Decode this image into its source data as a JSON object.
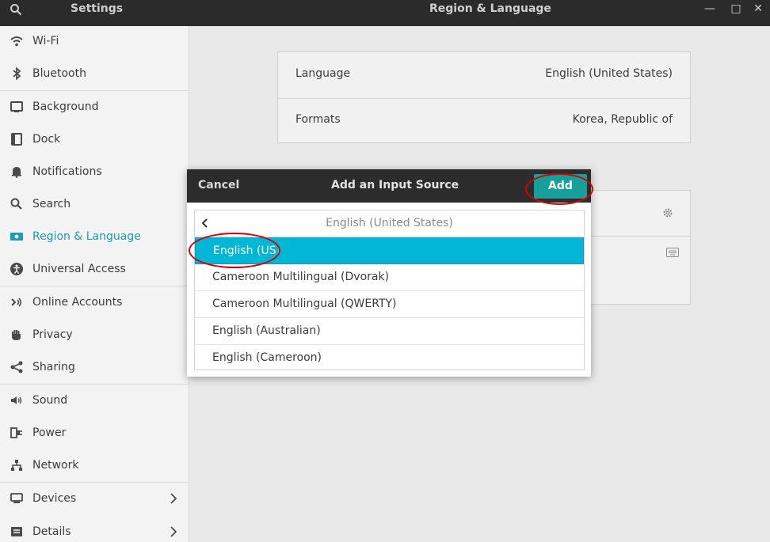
{
  "header": {
    "app_title": "Settings",
    "page_title": "Region & Language",
    "search_icon": "search-icon",
    "window_buttons": [
      "minimize-icon",
      "maximize-icon",
      "close-icon"
    ]
  },
  "sidebar": {
    "items": [
      {
        "label": "Wi-Fi",
        "icon": "wifi-icon"
      },
      {
        "label": "Bluetooth",
        "icon": "bluetooth-icon"
      },
      {
        "label": "Background",
        "icon": "background-icon"
      },
      {
        "label": "Dock",
        "icon": "dock-icon"
      },
      {
        "label": "Notifications",
        "icon": "bell-icon"
      },
      {
        "label": "Search",
        "icon": "search-icon"
      },
      {
        "label": "Region & Language",
        "icon": "flag-icon",
        "active": true
      },
      {
        "label": "Universal Access",
        "icon": "accessibility-icon"
      },
      {
        "label": "Online Accounts",
        "icon": "online-accounts-icon"
      },
      {
        "label": "Privacy",
        "icon": "hand-icon"
      },
      {
        "label": "Sharing",
        "icon": "share-icon"
      },
      {
        "label": "Sound",
        "icon": "speaker-icon"
      },
      {
        "label": "Power",
        "icon": "power-plug-icon"
      },
      {
        "label": "Network",
        "icon": "network-icon"
      },
      {
        "label": "Devices",
        "icon": "devices-icon",
        "has_chevron": true
      },
      {
        "label": "Details",
        "icon": "details-icon",
        "has_chevron": true
      }
    ],
    "active_color": "#1b9bb5"
  },
  "main": {
    "language_label": "Language",
    "language_value": "English (United States)",
    "formats_label": "Formats",
    "formats_value": "Korea, Republic of"
  },
  "dialog": {
    "cancel_label": "Cancel",
    "title": "Add an Input Source",
    "add_label": "Add",
    "add_color": "#17a09a",
    "list_header": "English (United States)",
    "items": [
      {
        "label": "English (US)",
        "selected": true
      },
      {
        "label": "Cameroon Multilingual (Dvorak)"
      },
      {
        "label": "Cameroon Multilingual (QWERTY)"
      },
      {
        "label": "English (Australian)"
      },
      {
        "label": "English (Cameroon)"
      }
    ],
    "selection_color": "#00b7d6"
  },
  "annotation_color": "#d90000"
}
